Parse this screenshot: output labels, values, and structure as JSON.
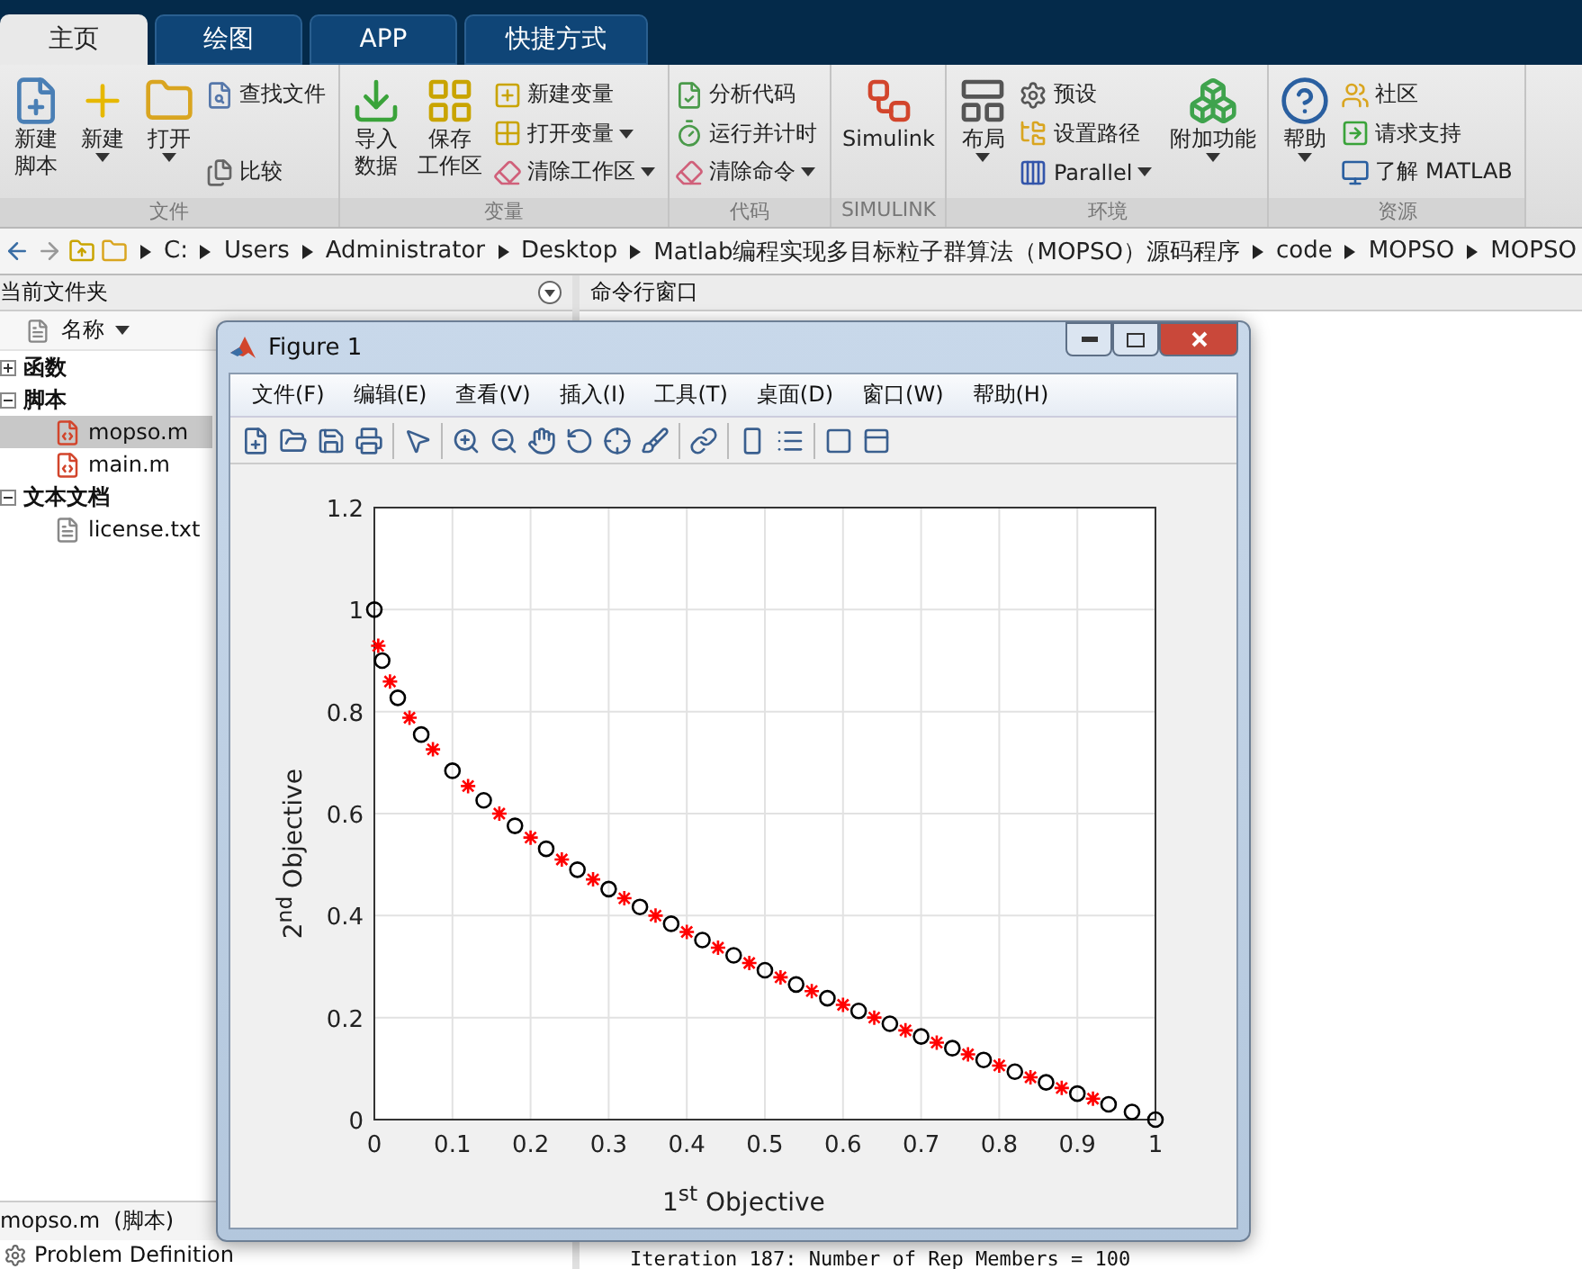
{
  "tabs": [
    {
      "label": "主页",
      "selected": true
    },
    {
      "label": "绘图",
      "selected": false
    },
    {
      "label": "APP",
      "selected": false
    },
    {
      "label": "快捷方式",
      "selected": false
    }
  ],
  "ribbon": {
    "groups": [
      {
        "label": "文件",
        "items": [
          {
            "lines": [
              "新建",
              "脚本"
            ],
            "kind": "large",
            "dropdown": false
          },
          {
            "lines": [
              "新建"
            ],
            "kind": "large",
            "dropdown": true
          },
          {
            "lines": [
              "打开"
            ],
            "kind": "large",
            "dropdown": true
          },
          {
            "lines": [
              "查找文件"
            ],
            "kind": "small",
            "dropdown": false
          },
          {
            "lines": [
              "比较"
            ],
            "kind": "small",
            "dropdown": false
          }
        ]
      },
      {
        "label": "变量",
        "items": [
          {
            "lines": [
              "导入",
              "数据"
            ],
            "kind": "large",
            "dropdown": false
          },
          {
            "lines": [
              "保存",
              "工作区"
            ],
            "kind": "large",
            "dropdown": false
          },
          {
            "lines": [
              "新建变量"
            ],
            "kind": "small",
            "dropdown": false
          },
          {
            "lines": [
              "打开变量"
            ],
            "kind": "small",
            "dropdown": true
          },
          {
            "lines": [
              "清除工作区"
            ],
            "kind": "small",
            "dropdown": true
          }
        ]
      },
      {
        "label": "代码",
        "items": [
          {
            "lines": [
              "分析代码"
            ],
            "kind": "small",
            "dropdown": false
          },
          {
            "lines": [
              "运行并计时"
            ],
            "kind": "small",
            "dropdown": false
          },
          {
            "lines": [
              "清除命令"
            ],
            "kind": "small",
            "dropdown": true
          }
        ]
      },
      {
        "label": "SIMULINK",
        "items": [
          {
            "lines": [
              "Simulink"
            ],
            "kind": "large",
            "dropdown": false
          }
        ]
      },
      {
        "label": "环境",
        "items": [
          {
            "lines": [
              "布局"
            ],
            "kind": "large",
            "dropdown": true
          },
          {
            "lines": [
              "预设"
            ],
            "kind": "small",
            "dropdown": false
          },
          {
            "lines": [
              "设置路径"
            ],
            "kind": "small",
            "dropdown": false
          },
          {
            "lines": [
              "Parallel"
            ],
            "kind": "small",
            "dropdown": true
          },
          {
            "lines": [
              "附加功能"
            ],
            "kind": "large",
            "dropdown": true
          }
        ]
      },
      {
        "label": "资源",
        "items": [
          {
            "lines": [
              "帮助"
            ],
            "kind": "large",
            "dropdown": true
          },
          {
            "lines": [
              "社区"
            ],
            "kind": "small",
            "dropdown": false
          },
          {
            "lines": [
              "请求支持"
            ],
            "kind": "small",
            "dropdown": false
          },
          {
            "lines": [
              "了解 MATLAB"
            ],
            "kind": "small",
            "dropdown": false
          }
        ]
      }
    ]
  },
  "address_bar": {
    "path": [
      "C:",
      "Users",
      "Administrator",
      "Desktop",
      "Matlab编程实现多目标粒子群算法（MOPSO）源码程序",
      "code",
      "MOPSO",
      "MOPSO"
    ]
  },
  "current_folder": {
    "title": "当前文件夹",
    "column": "名称",
    "tree": [
      {
        "label": "函数",
        "kind": "folder",
        "expanded": false,
        "selected": false
      },
      {
        "label": "脚本",
        "kind": "folder",
        "expanded": true,
        "selected": false,
        "children": [
          {
            "label": "mopso.m",
            "kind": "script",
            "selected": true
          },
          {
            "label": "main.m",
            "kind": "script",
            "selected": false
          }
        ]
      },
      {
        "label": "文本文档",
        "kind": "folder",
        "expanded": true,
        "selected": false,
        "children": [
          {
            "label": "license.txt",
            "kind": "text",
            "selected": false
          }
        ]
      }
    ],
    "details": "mopso.m  (脚本)",
    "outline": "Problem Definition"
  },
  "command_window": {
    "title": "命令行窗口",
    "lines": [
      "Iteration 187: Number of Rep Members = 100"
    ]
  },
  "figure": {
    "title": "Figure 1",
    "menu": [
      "文件(F)",
      "编辑(E)",
      "查看(V)",
      "插入(I)",
      "工具(T)",
      "桌面(D)",
      "窗口(W)",
      "帮助(H)"
    ],
    "chart_data": {
      "type": "scatter",
      "grid": true,
      "xlabel": "1$^{st}$ Objective",
      "ylabel": "2$^{nd}$ Objective",
      "xlim": [
        0,
        1
      ],
      "ylim": [
        0,
        1.2
      ],
      "xticks": [
        0,
        0.1,
        0.2,
        0.3,
        0.4,
        0.5,
        0.6,
        0.7,
        0.8,
        0.9,
        1
      ],
      "yticks": [
        0,
        0.2,
        0.4,
        0.6,
        0.8,
        1,
        1.2
      ],
      "series": [
        {
          "marker": "circle",
          "color": "#000000",
          "x": [
            0,
            0.01,
            0.03,
            0.06,
            0.1,
            0.14,
            0.18,
            0.22,
            0.26,
            0.3,
            0.34,
            0.38,
            0.42,
            0.46,
            0.5,
            0.54,
            0.58,
            0.62,
            0.66,
            0.7,
            0.74,
            0.78,
            0.82,
            0.86,
            0.9,
            0.94,
            0.97,
            1
          ],
          "values": [
            1,
            0.9,
            0.827,
            0.755,
            0.684,
            0.626,
            0.576,
            0.531,
            0.49,
            0.452,
            0.417,
            0.384,
            0.352,
            0.322,
            0.293,
            0.265,
            0.238,
            0.213,
            0.188,
            0.163,
            0.14,
            0.117,
            0.094,
            0.073,
            0.051,
            0.03,
            0.015,
            0
          ]
        },
        {
          "marker": "cross",
          "color": "#ff0000",
          "x": [
            0.005,
            0.02,
            0.045,
            0.075,
            0.12,
            0.16,
            0.2,
            0.24,
            0.28,
            0.32,
            0.36,
            0.4,
            0.44,
            0.48,
            0.52,
            0.56,
            0.6,
            0.64,
            0.68,
            0.72,
            0.76,
            0.8,
            0.84,
            0.88,
            0.92
          ],
          "values": [
            0.929,
            0.859,
            0.788,
            0.726,
            0.654,
            0.6,
            0.553,
            0.51,
            0.471,
            0.434,
            0.4,
            0.368,
            0.337,
            0.307,
            0.279,
            0.252,
            0.225,
            0.2,
            0.175,
            0.151,
            0.128,
            0.106,
            0.083,
            0.062,
            0.041
          ]
        }
      ]
    }
  }
}
